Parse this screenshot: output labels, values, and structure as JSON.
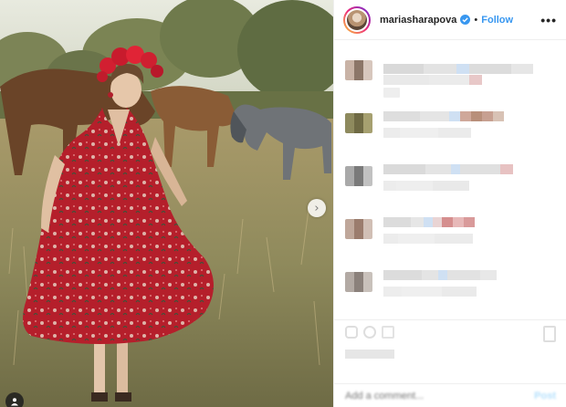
{
  "post": {
    "photo_alt": "",
    "has_next_image": true
  },
  "header": {
    "username": "mariasharapova",
    "verified": true,
    "separator": "•",
    "follow_label": "Follow",
    "more_label": "•••"
  },
  "comments": [
    {
      "id": 1
    },
    {
      "id": 2
    },
    {
      "id": 3
    },
    {
      "id": 4
    },
    {
      "id": 5
    }
  ],
  "composer": {
    "placeholder": "Add a comment...",
    "post_label": "Post"
  },
  "colors": {
    "accent": "#3897f0",
    "post_disabled": "#b2dffc",
    "divider": "#efefef",
    "dress": "#b8202a"
  },
  "icons": {
    "verified": "verified-badge-icon",
    "next": "chevron-right-icon",
    "tag": "user-tag-icon",
    "more": "more-options-icon",
    "heart": "heart-icon",
    "comment": "comment-icon",
    "share": "share-icon",
    "save": "bookmark-icon"
  }
}
